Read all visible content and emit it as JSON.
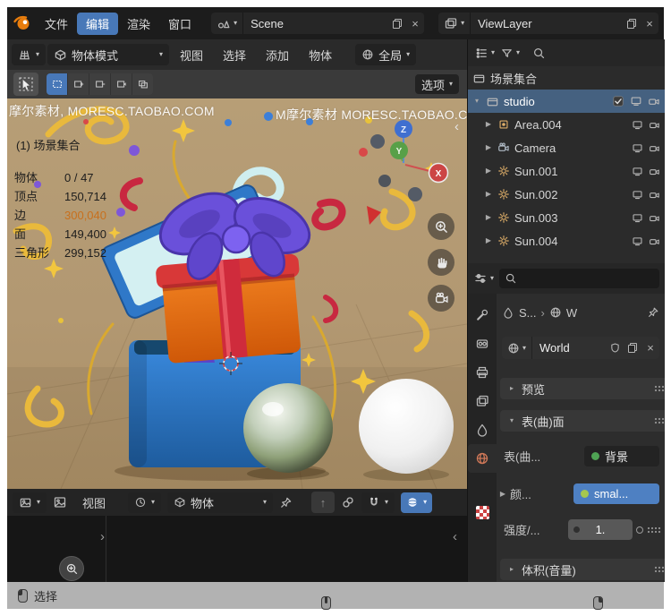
{
  "colors": {
    "accent": "#4878b8",
    "viewport_bg": "#b49a70",
    "selected_row": "#456180",
    "stat_highlight": "#c8701d",
    "value_blue": "#4e80c2",
    "socket_green": "#4fa354"
  },
  "icons": {
    "caret": "▾",
    "expander_open": "▾",
    "expander_closed": "▸",
    "play": "▶",
    "chev_right": "›",
    "chev_left": "‹",
    "close": "×",
    "up_arrow": "↑"
  },
  "topbar": {
    "menus": [
      {
        "label": "文件"
      },
      {
        "label": "编辑"
      },
      {
        "label": "渲染"
      },
      {
        "label": "窗口"
      }
    ],
    "scene": {
      "value": "Scene"
    },
    "viewlayer": {
      "value": "ViewLayer"
    }
  },
  "viewport_header": {
    "mode": "物体模式",
    "menus": [
      {
        "label": "视图"
      },
      {
        "label": "选择"
      },
      {
        "label": "添加"
      },
      {
        "label": "物体"
      }
    ],
    "orientation": "全局"
  },
  "tool_row": {
    "options": "选项"
  },
  "viewport": {
    "watermark_left": "摩尔素材, MORESC.TAOBAO.COM",
    "watermark_right": "M摩尔素材 MORESC.TAOBAO.COM",
    "collection": "(1) 场景集合",
    "stats": [
      {
        "label": "物体",
        "value": "0 / 47"
      },
      {
        "label": "顶点",
        "value": "150,714"
      },
      {
        "label": "边",
        "value": "300,040"
      },
      {
        "label": "面",
        "value": "149,400"
      },
      {
        "label": "三角形",
        "value": "299,152"
      }
    ],
    "gizmo": {
      "x": "X",
      "y": "Y",
      "z": "Z"
    }
  },
  "outliner": {
    "root": "场景集合",
    "rows": [
      {
        "label": "studio"
      },
      {
        "label": "Area.004"
      },
      {
        "label": "Camera"
      },
      {
        "label": "Sun.001"
      },
      {
        "label": "Sun.002"
      },
      {
        "label": "Sun.003"
      },
      {
        "label": "Sun.004"
      }
    ]
  },
  "properties": {
    "breadcrumb": {
      "scene": "S...",
      "world": "W"
    },
    "world_name": "World",
    "panels": {
      "preview": "预览",
      "surface": "表(曲)面",
      "volume": "体积(音量)"
    },
    "rows": {
      "surface_label": "表(曲...",
      "surface_value": "背景",
      "color_label": "颜...",
      "color_value": "smal...",
      "strength_label": "强度/...",
      "strength_value": "1."
    }
  },
  "bottom_editor": {
    "view_menu": "视图",
    "object_menu": "物体"
  },
  "statusbar": {
    "select": "选择"
  }
}
